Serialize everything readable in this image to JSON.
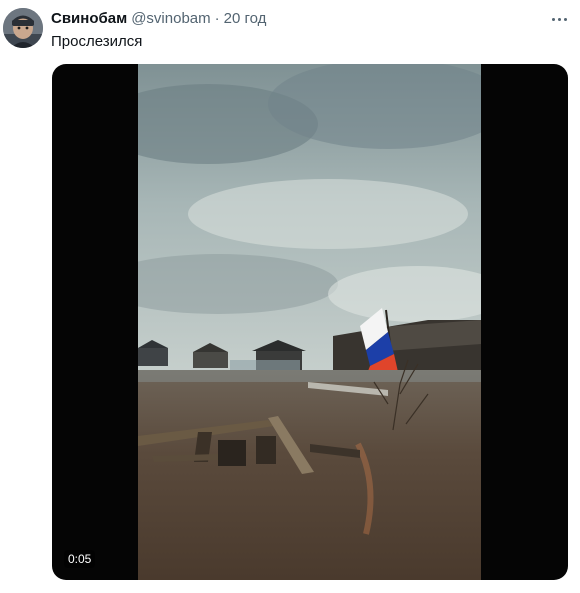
{
  "tweet": {
    "author_name": "Свинобам",
    "author_handle": "@svinobam",
    "separator": "·",
    "time": "20 год",
    "text": "Прослезился"
  },
  "video": {
    "duration": "0:05"
  },
  "icons": {
    "more": "more-options-icon",
    "avatar": "avatar"
  },
  "colors": {
    "text_primary": "#0f1419",
    "text_secondary": "#536471",
    "flag_white": "#f4f4f4",
    "flag_blue": "#1c3fa8",
    "flag_red": "#e0452b"
  }
}
